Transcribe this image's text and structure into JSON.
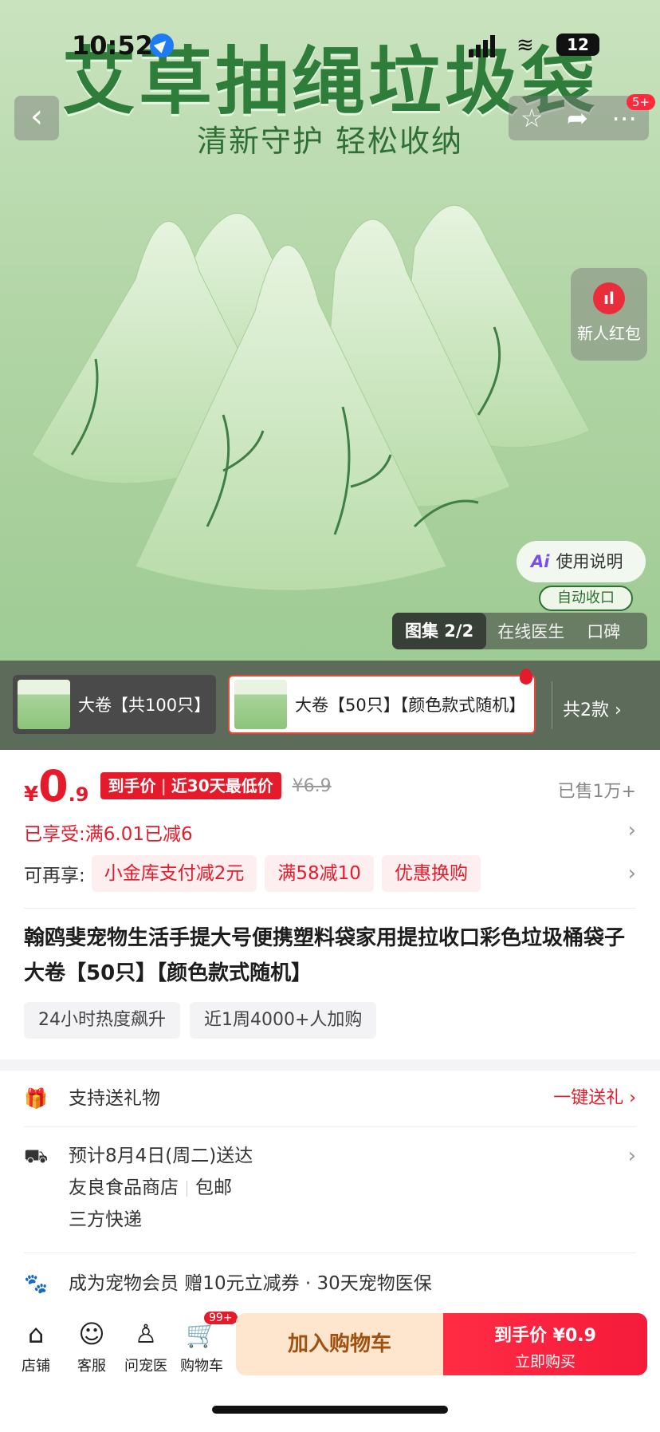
{
  "status_bar": {
    "time": "10:52",
    "battery": "12"
  },
  "hero": {
    "title": "艾草抽绳垃圾袋",
    "subtitle": "清新守护 轻松收纳",
    "cart_badge": "5+",
    "red_packet_label": "新人红包",
    "guide_ai": "Ai",
    "guide_label": "使用说明",
    "auto_close": "自动收口",
    "tabs": {
      "gallery": "图集 2/2",
      "doctor": "在线医生",
      "reviews": "口碑"
    }
  },
  "sku": {
    "options": [
      "大卷【共100只】",
      "大卷【50只】【颜色款式随机】"
    ],
    "count": "共2款 ›"
  },
  "price": {
    "currency": "¥",
    "integer": "0",
    "decimal": ".9",
    "tag_main": "到手价",
    "tag_extra": "近30天最低价",
    "original": "¥6.9",
    "sold": "已售1万+",
    "enjoyed": "已享受:满6.01已减6",
    "more_label": "可再享:",
    "coupons": [
      "小金库支付减2元",
      "满58减10",
      "优惠换购"
    ]
  },
  "product": {
    "title": "翰鸥斐宠物生活手提大号便携塑料袋家用提拉收口彩色垃圾桶袋子 大卷【50只】【颜色款式随机】",
    "tags": [
      "24小时热度飙升",
      "近1周4000+人加购"
    ]
  },
  "services": {
    "gift": {
      "label": "支持送礼物",
      "action": "一键送礼 ›"
    },
    "delivery": {
      "line1": "预计8月4日(周二)送达",
      "shop": "友良食品商店",
      "shipping": "包邮",
      "courier": "三方快递"
    },
    "member": {
      "label": "成为宠物会员 赠10元立减券 · 30天宠物医保"
    }
  },
  "bottom_bar": {
    "items": [
      {
        "label": "店铺",
        "icon": "shop-icon"
      },
      {
        "label": "客服",
        "icon": "chat-icon"
      },
      {
        "label": "问宠医",
        "icon": "vet-icon"
      },
      {
        "label": "购物车",
        "icon": "cart-icon"
      }
    ],
    "cart_badge": "99+",
    "add_to_cart": "加入购物车",
    "buy_line1": "到手价 ¥0.9",
    "buy_line2": "立即购买"
  },
  "colors": {
    "accent": "#e51b2b",
    "brand_green": "#2f7d3a",
    "add_cart_bg": "#fde6cd"
  }
}
